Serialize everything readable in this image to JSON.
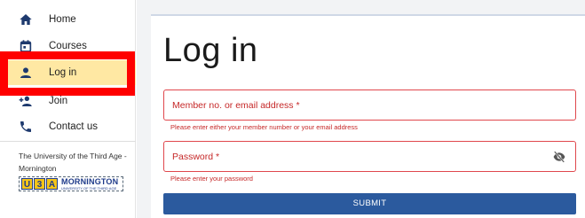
{
  "nav": {
    "items": [
      {
        "label": "Home",
        "icon": "home-icon"
      },
      {
        "label": "Courses",
        "icon": "calendar-icon"
      },
      {
        "label": "Log in",
        "icon": "person-icon",
        "active": true
      },
      {
        "label": "Join",
        "icon": "person-add-icon"
      },
      {
        "label": "Contact us",
        "icon": "phone-icon"
      }
    ]
  },
  "org": {
    "name": "The University of the Third Age - Mornington",
    "logo_letters": [
      "U",
      "3",
      "A"
    ],
    "logo_text": "MORNINGTON",
    "logo_subtext": "UNIVERSITY OF THE THIRD AGE"
  },
  "form": {
    "title": "Log in",
    "member_field": {
      "placeholder": "Member no. or email address *",
      "error": "Please enter either your member number or your email address"
    },
    "password_field": {
      "placeholder": "Password *",
      "error": "Please enter your password"
    },
    "submit_label": "SUBMIT"
  },
  "colors": {
    "accent": "#2b5a9e",
    "error": "#c62828",
    "active_bg": "#ffe8a3",
    "annotation": "#ff0000",
    "icon": "#1e3a6e"
  }
}
